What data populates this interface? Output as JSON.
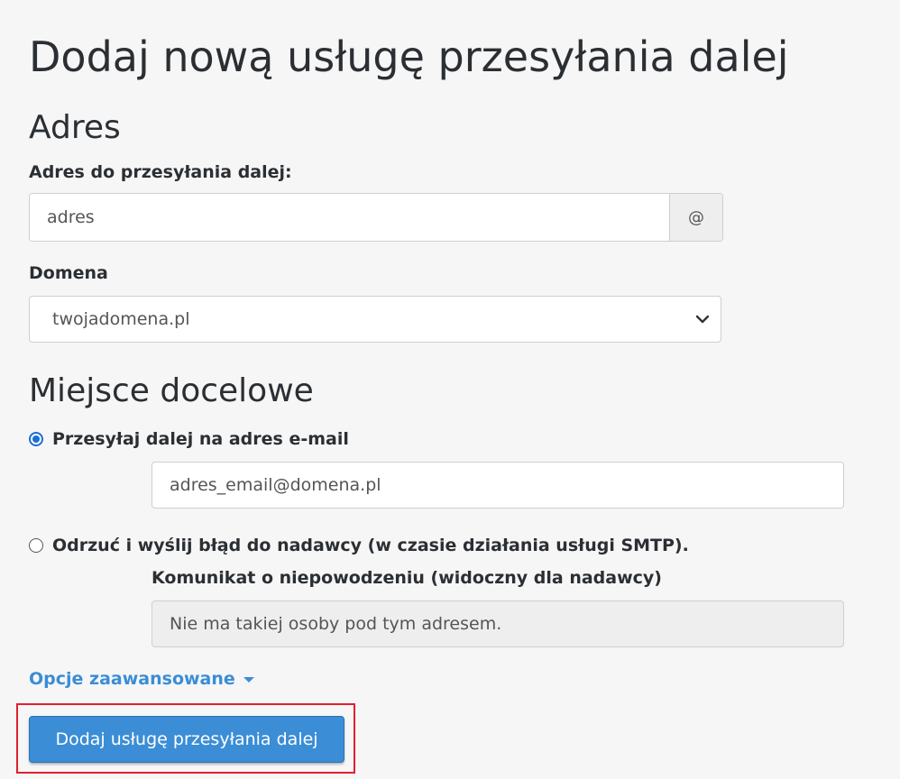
{
  "page": {
    "title": "Dodaj nową usługę przesyłania dalej"
  },
  "address_section": {
    "heading": "Adres",
    "forward_label": "Adres do przesyłania dalej:",
    "forward_value": "adres",
    "at_symbol": "@",
    "domain_label": "Domena",
    "domain_selected": "twojadomena.pl"
  },
  "destination_section": {
    "heading": "Miejsce docelowe",
    "option_forward": {
      "label": "Przesyłaj dalej na adres e-mail",
      "checked": true,
      "email_value": "adres_email@domena.pl"
    },
    "option_discard": {
      "label": "Odrzuć i wyślij błąd do nadawcy (w czasie działania usługi SMTP).",
      "checked": false,
      "message_label": "Komunikat o niepowodzeniu (widoczny dla nadawcy)",
      "message_value": "Nie ma takiej osoby pod tym adresem."
    }
  },
  "advanced": {
    "label": "Opcje zaawansowane"
  },
  "submit": {
    "label": "Dodaj usługę przesyłania dalej"
  },
  "colors": {
    "primary": "#3b8dd6",
    "radio_checked": "#1a6fd6",
    "highlight": "#e0202e",
    "background": "#f6f6f6"
  },
  "icons": {
    "domain_dropdown": "chevron-down-icon",
    "advanced_toggle": "caret-down-icon"
  }
}
